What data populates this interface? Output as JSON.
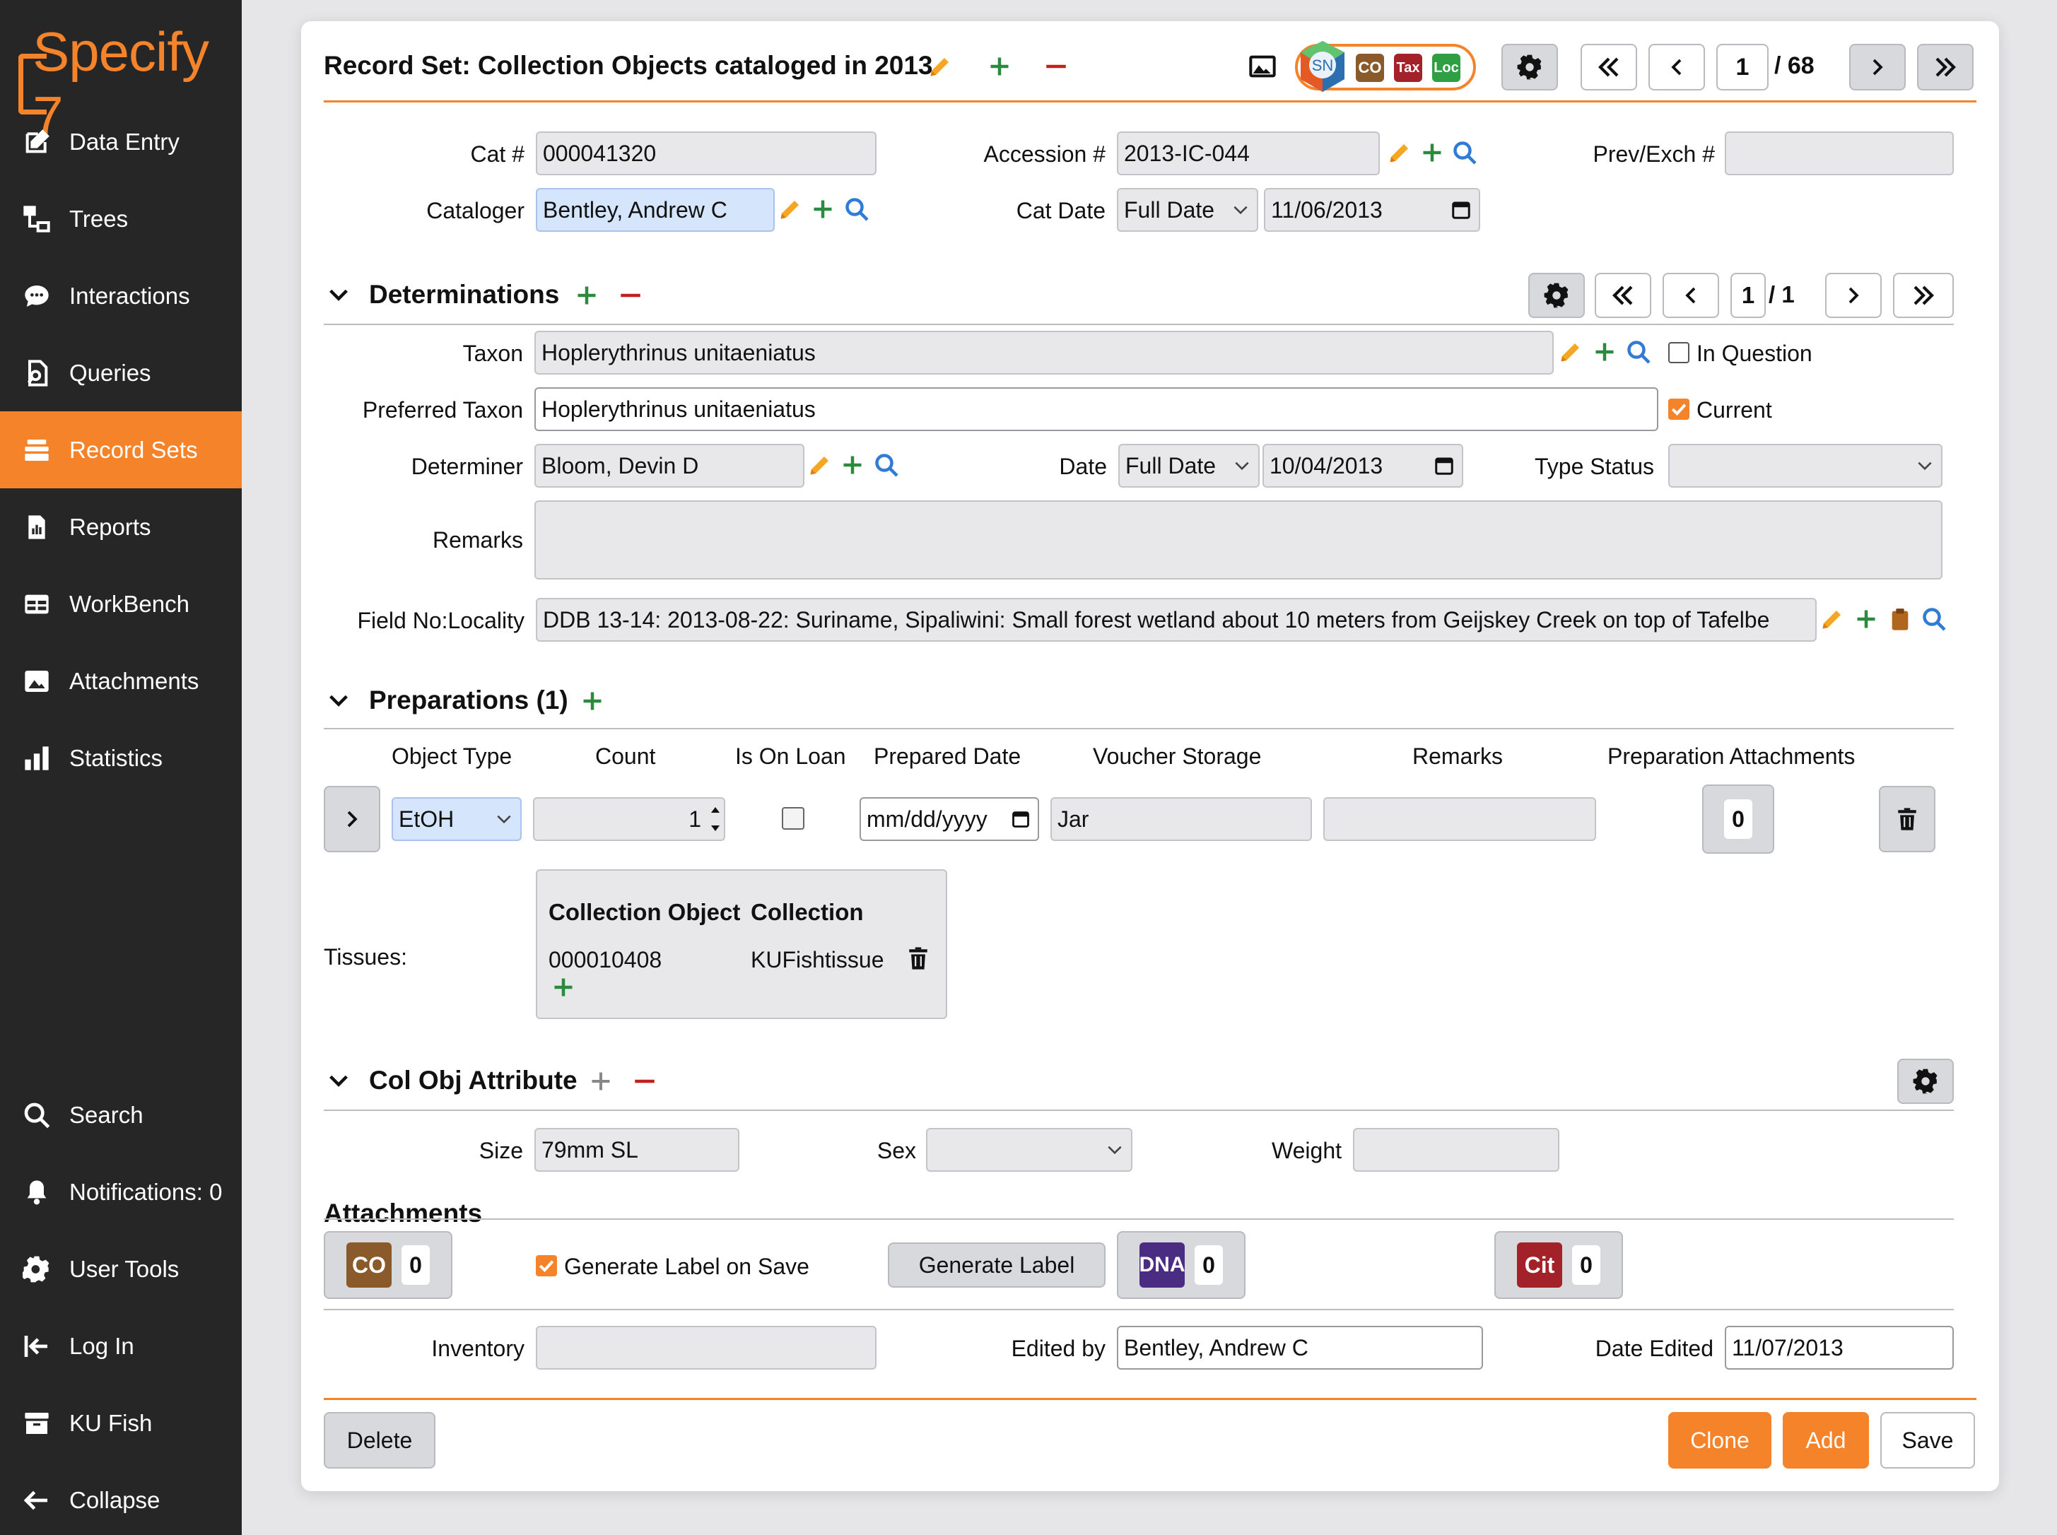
{
  "app": {
    "brand": "Specify 7",
    "accent": "#f5832a"
  },
  "sidebar": {
    "items": [
      {
        "label": "Data Entry",
        "icon": "edit-icon"
      },
      {
        "label": "Trees",
        "icon": "tree-icon"
      },
      {
        "label": "Interactions",
        "icon": "chat-icon"
      },
      {
        "label": "Queries",
        "icon": "query-icon"
      },
      {
        "label": "Record Sets",
        "icon": "record-sets-icon",
        "active": true
      },
      {
        "label": "Reports",
        "icon": "report-icon"
      },
      {
        "label": "WorkBench",
        "icon": "table-icon"
      },
      {
        "label": "Attachments",
        "icon": "image-icon"
      },
      {
        "label": "Statistics",
        "icon": "bar-chart-icon"
      }
    ],
    "bottom": [
      {
        "label": "Search",
        "icon": "search-icon"
      },
      {
        "label": "Notifications: 0",
        "icon": "bell-icon"
      },
      {
        "label": "User Tools",
        "icon": "gear-icon"
      },
      {
        "label": "Log In",
        "icon": "login-icon"
      },
      {
        "label": "KU Fish",
        "icon": "archive-icon"
      },
      {
        "label": "Collapse",
        "icon": "arrow-left-icon"
      }
    ]
  },
  "header": {
    "title": "Record Set: Collection Objects cataloged in 2013",
    "badges": [
      "SN",
      "CO",
      "Tax",
      "Loc"
    ],
    "page_current": "1",
    "page_total": "/ 68"
  },
  "form": {
    "cat_label": "Cat #",
    "cat_value": "000041320",
    "accession_label": "Accession #",
    "accession_value": "2013-IC-044",
    "prevexch_label": "Prev/Exch #",
    "prevexch_value": "",
    "cataloger_label": "Cataloger",
    "cataloger_value": "Bentley, Andrew C",
    "catdate_label": "Cat Date",
    "catdate_type": "Full Date",
    "catdate_value": "11/06/2013"
  },
  "determinations": {
    "title": "Determinations",
    "page_current": "1",
    "page_total": "/ 1",
    "taxon_label": "Taxon",
    "taxon_value": "Hoplerythrinus unitaeniatus",
    "in_question_label": "In Question",
    "preferred_label": "Preferred Taxon",
    "preferred_value": "Hoplerythrinus unitaeniatus",
    "current_label": "Current",
    "determiner_label": "Determiner",
    "determiner_value": "Bloom, Devin D",
    "date_label": "Date",
    "date_type": "Full Date",
    "date_value": "10/04/2013",
    "type_status_label": "Type Status",
    "type_status_value": "",
    "remarks_label": "Remarks",
    "remarks_value": "",
    "locality_label": "Field No:Locality",
    "locality_value": "DDB 13-14: 2013-08-22: Suriname, Sipaliwini: Small forest wetland about 10 meters from Geijskey Creek on top of Tafelbe"
  },
  "preparations": {
    "title": "Preparations (1)",
    "columns": [
      "Object Type",
      "Count",
      "Is On Loan",
      "Prepared Date",
      "Voucher Storage",
      "Remarks",
      "Preparation Attachments"
    ],
    "row": {
      "object_type": "EtOH",
      "count": "1",
      "prepared_date": "mm/dd/yyyy",
      "voucher_storage": "Jar",
      "remarks": "",
      "attachments": "0"
    },
    "tissues_label": "Tissues:",
    "tissue_headers": [
      "Collection Object",
      "Collection"
    ],
    "tissue_row": {
      "collection_object": "000010408",
      "collection": "KUFishtissue"
    }
  },
  "colobj_attr": {
    "title": "Col Obj Attribute",
    "size_label": "Size",
    "size_value": "79mm SL",
    "sex_label": "Sex",
    "sex_value": "",
    "weight_label": "Weight",
    "weight_value": ""
  },
  "attachments": {
    "title": "Attachments",
    "co_badge": "CO",
    "co_count": "0",
    "generate_on_save_label": "Generate Label on Save",
    "generate_label_button": "Generate Label",
    "dna_badge": "DNA",
    "dna_count": "0",
    "cit_badge": "Cit",
    "cit_count": "0"
  },
  "footer_fields": {
    "inventory_label": "Inventory",
    "inventory_value": "",
    "edited_by_label": "Edited by",
    "edited_by_value": "Bentley, Andrew C",
    "date_edited_label": "Date Edited",
    "date_edited_value": "11/07/2013"
  },
  "actions": {
    "delete": "Delete",
    "clone": "Clone",
    "add": "Add",
    "save": "Save"
  }
}
